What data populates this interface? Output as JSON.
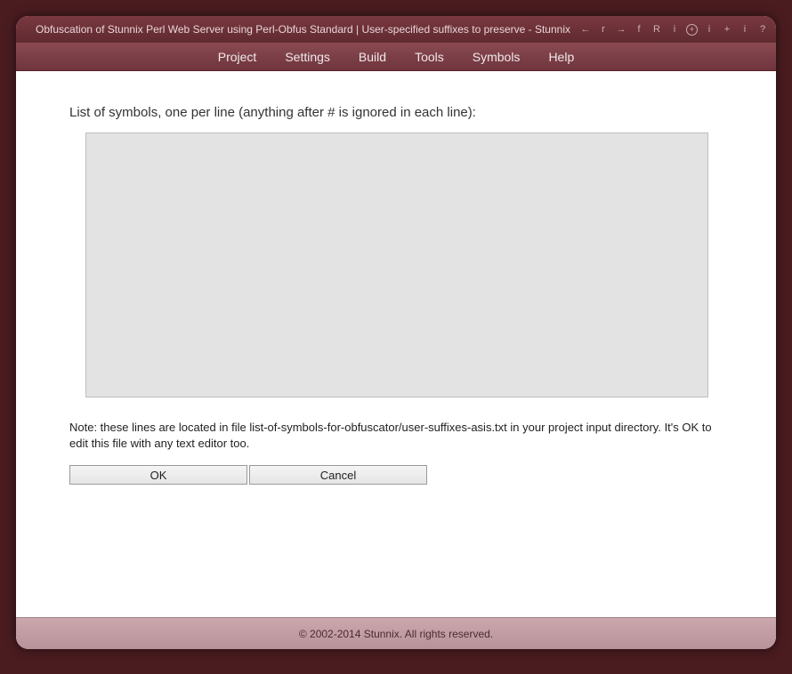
{
  "title": "Obfuscation of Stunnix Perl Web Server using Perl-Obfus Standard | User-specified suffixes to preserve - Stunnix",
  "menu": {
    "project": "Project",
    "settings": "Settings",
    "build": "Build",
    "tools": "Tools",
    "symbols": "Symbols",
    "help": "Help"
  },
  "main": {
    "instruction": "List of symbols, one per line (anything after # is ignored in each line):",
    "textarea_value": "",
    "note": "Note: these lines are located in file list-of-symbols-for-obfuscator/user-suffixes-asis.txt in your project input directory. It's OK to edit this file with any text editor too.",
    "ok_label": "OK",
    "cancel_label": "Cancel"
  },
  "footer": "© 2002-2014 Stunnix. All rights reserved.",
  "icons": {
    "back": "←",
    "bar1": "r",
    "forward": "→",
    "bar2": "f",
    "reload": "R",
    "bar3": "i",
    "plus_circle": "+",
    "bar4": "i",
    "plus": "+",
    "bar5": "i",
    "help": "?"
  }
}
